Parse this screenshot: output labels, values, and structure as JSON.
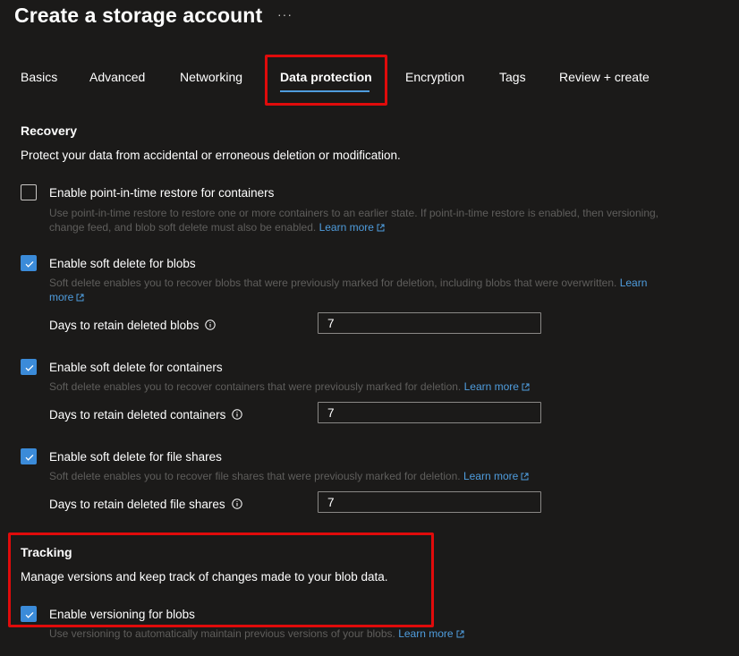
{
  "header": {
    "title": "Create a storage account",
    "more_label": "···"
  },
  "tabs": [
    {
      "label": "Basics"
    },
    {
      "label": "Advanced"
    },
    {
      "label": "Networking"
    },
    {
      "label": "Data protection",
      "active": true
    },
    {
      "label": "Encryption"
    },
    {
      "label": "Tags"
    },
    {
      "label": "Review + create"
    }
  ],
  "recovery": {
    "title": "Recovery",
    "description": "Protect your data from accidental or erroneous deletion or modification.",
    "options": [
      {
        "label": "Enable point-in-time restore for containers",
        "checked": false,
        "help": "Use point-in-time restore to restore one or more containers to an earlier state. If point-in-time restore is enabled, then versioning, change feed, and blob soft delete must also be enabled.",
        "link": "Learn more"
      },
      {
        "label": "Enable soft delete for blobs",
        "checked": true,
        "help": "Soft delete enables you to recover blobs that were previously marked for deletion, including blobs that were overwritten.",
        "link": "Learn more",
        "field_label": "Days to retain deleted blobs",
        "field_value": "7"
      },
      {
        "label": "Enable soft delete for containers",
        "checked": true,
        "help": "Soft delete enables you to recover containers that were previously marked for deletion.",
        "link": "Learn more",
        "field_label": "Days to retain deleted containers",
        "field_value": "7"
      },
      {
        "label": "Enable soft delete for file shares",
        "checked": true,
        "help": "Soft delete enables you to recover file shares that were previously marked for deletion.",
        "link": "Learn more",
        "field_label": "Days to retain deleted file shares",
        "field_value": "7"
      }
    ]
  },
  "tracking": {
    "title": "Tracking",
    "description": "Manage versions and keep track of changes made to your blob data.",
    "options": [
      {
        "label": "Enable versioning for blobs",
        "checked": true,
        "help": "Use versioning to automatically maintain previous versions of your blobs.",
        "link": "Learn more"
      }
    ]
  },
  "colors": {
    "background": "#1b1a19",
    "accent": "#3b8bd9",
    "link": "#4f9dde",
    "highlight": "#e00b0b",
    "muted_text": "#5f5e5c"
  },
  "icons": {
    "checkmark": "checkmark-icon",
    "info": "info-icon",
    "external_link": "external-link-icon"
  }
}
